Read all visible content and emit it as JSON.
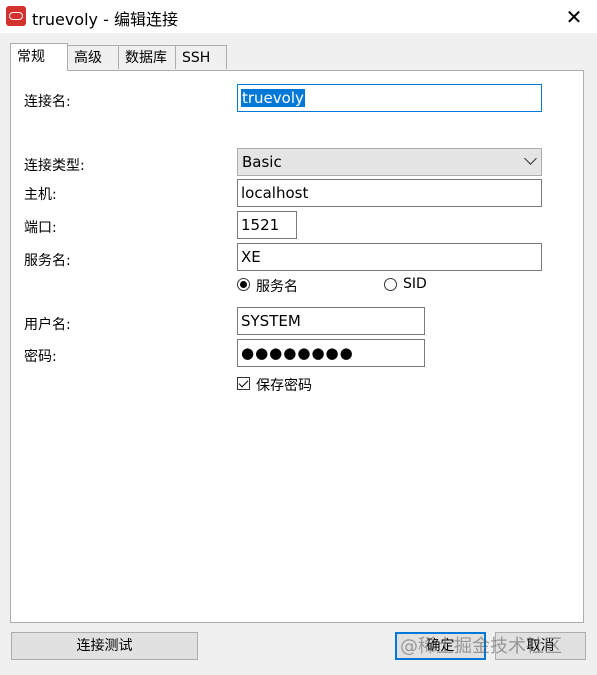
{
  "window": {
    "title": "truevoly - 编辑连接",
    "close_glyph": "✕"
  },
  "tabs": [
    {
      "label": "常规",
      "active": true
    },
    {
      "label": "高级",
      "active": false
    },
    {
      "label": "数据库",
      "active": false
    },
    {
      "label": "SSH",
      "active": false
    }
  ],
  "form": {
    "connection_name_label": "连接名:",
    "connection_name_value": "truevoly",
    "connection_type_label": "连接类型:",
    "connection_type_value": "Basic",
    "host_label": "主机:",
    "host_value": "localhost",
    "port_label": "端口:",
    "port_value": "1521",
    "service_label": "服务名:",
    "service_value": "XE",
    "radio_service_label": "服务名",
    "radio_sid_label": "SID",
    "username_label": "用户名:",
    "username_value": "SYSTEM",
    "password_label": "密码:",
    "password_mask": "●●●●●●●●",
    "save_password_label": "保存密码"
  },
  "buttons": {
    "test_label": "连接测试",
    "ok_label": "确定",
    "cancel_label": "取消"
  },
  "watermark": "@稀土掘金技术社区",
  "colors": {
    "accent": "#0078d7",
    "app_icon": "#d3312b"
  }
}
